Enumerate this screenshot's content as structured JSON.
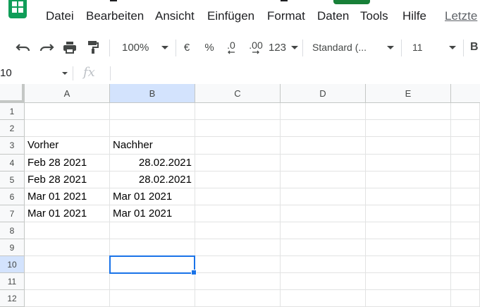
{
  "menu": {
    "items": [
      "Datei",
      "Bearbeiten",
      "Ansicht",
      "Einfügen",
      "Format",
      "Daten",
      "Tools",
      "Hilfe",
      "Letzte"
    ]
  },
  "toolbar": {
    "zoom": "100%",
    "currency": "€",
    "percent": "%",
    "decrease_decimals": ".0",
    "increase_decimals": ".00",
    "more_formats": "123",
    "font": "Standard (...",
    "font_size": "11"
  },
  "formula_bar": {
    "name_box": "10",
    "fx_label": "fx",
    "content": ""
  },
  "grid": {
    "columns": [
      "A",
      "B",
      "C",
      "D",
      "E"
    ],
    "rows": [
      "1",
      "2",
      "3",
      "4",
      "5",
      "6",
      "7",
      "8",
      "9",
      "10",
      "11",
      "12"
    ],
    "cells": {
      "A3": "Vorher",
      "B3": "Nachher",
      "A4": "Feb 28 2021",
      "B4": "28.02.2021",
      "A5": "Feb 28 2021",
      "B5": "28.02.2021",
      "A6": "Mar 01 2021",
      "B6": "Mar 01 2021",
      "A7": "Mar 01 2021",
      "B7": "Mar 01 2021"
    },
    "selected_cell": "B10"
  },
  "colors": {
    "accent": "#1a73e8",
    "brand": "#0f9d58"
  }
}
